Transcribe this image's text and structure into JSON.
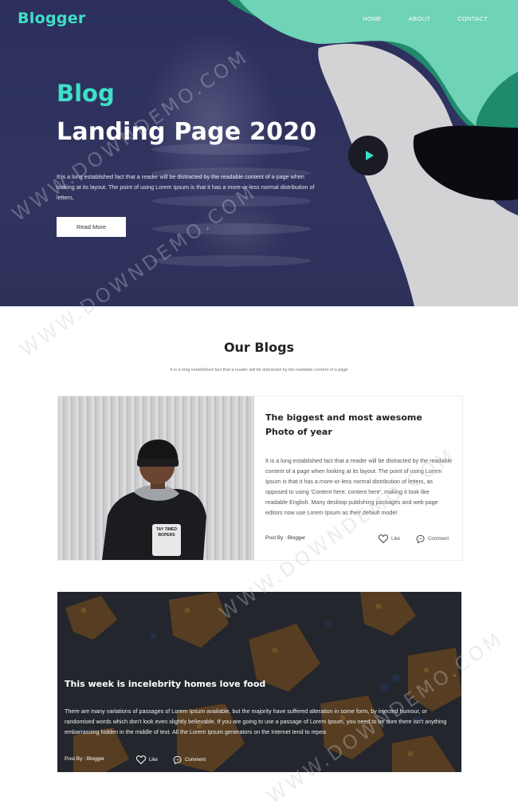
{
  "header": {
    "logo": "Blogger",
    "nav": [
      "HOME",
      "ABOUT",
      "CONTACT"
    ]
  },
  "hero": {
    "title_line1": "Blog",
    "title_line2": "Landing Page 2020",
    "text": "It is a long established fact that a reader will be distracted by the readable content of a page when looking at its layout. The point of using Lorem Ipsum is that it has a more-or-less normal distribution of letters,",
    "button_label": "Read More",
    "play_icon": "play-icon"
  },
  "blogs_section": {
    "title": "Our Blogs",
    "subtitle": "It is a long established fact that a reader will be distracted by the readable content of a page"
  },
  "post1": {
    "title": "The biggest and most awesome Photo of year",
    "text": "It is a long established fact that a reader will be distracted by the readable content of a page when looking at its layout. The point of using Lorem Ipsum is that it has a more-or-less normal distribution of letters, as opposed to using 'Content here, content here', making it look like readable English. Many desktop publishing packages and web page editors now use Lorem Ipsum as their default model",
    "author": "Post By : Blogger",
    "like_label": "Like",
    "comment_label": "Comment",
    "jacket_text": "TAY TIMED BOPERS"
  },
  "post2": {
    "title": "This week is incelebrity homes love food",
    "text": "There are many variations of passages of Lorem Ipsum available, but the majority have suffered alteration in some form, by injected humour, or randomised words which don't look even slightly believable. If you are going to use a passage of Lorem Ipsum, you need to be sure there isn't anything embarrassing hidden in the middle of text. All the Lorem Ipsum generators on the Internet tend to repea",
    "author": "Post By : Blogger",
    "like_label": "Like",
    "comment_label": "Comment"
  },
  "watermark": "WWW.DOWNDEMO.COM",
  "colors": {
    "accent": "#3ee0c8",
    "hero_bg": "#2f325e",
    "shape_green": "#1f8a6c",
    "shape_grey": "#d3d3d6",
    "play_bg": "#1a1b24"
  }
}
